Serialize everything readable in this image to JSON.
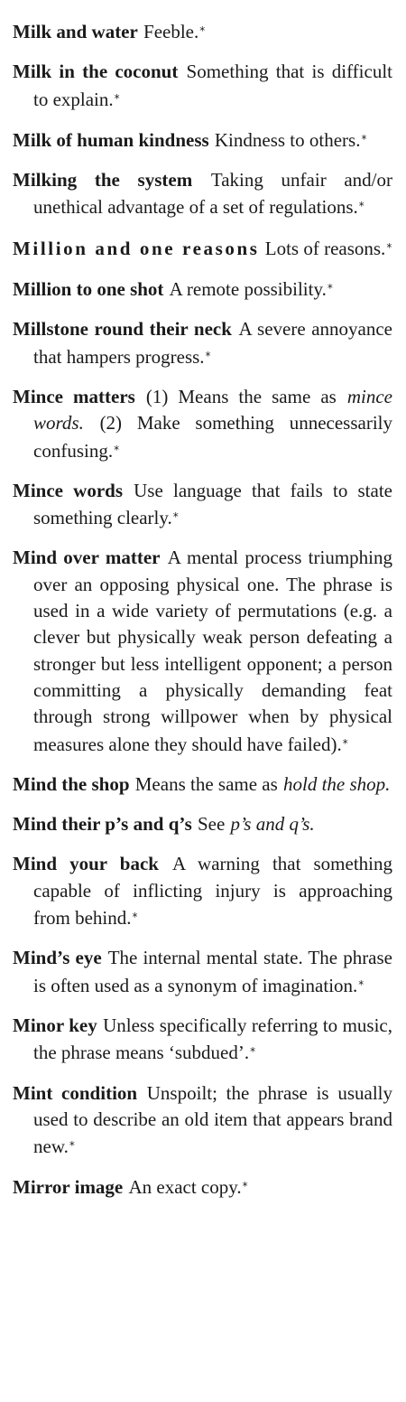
{
  "entries": [
    {
      "term": "Milk and water",
      "def": "Feeble.",
      "star": "*"
    },
    {
      "term": "Milk in the coconut",
      "def": "Something that is difficult to explain.",
      "star": "*"
    },
    {
      "term": "Milk of human kindness",
      "def": "Kindness to others.",
      "star": "*"
    },
    {
      "term": "Milking the system",
      "def": "Taking unfair and/or unethical advantage of a set of regulations.",
      "star": "*"
    },
    {
      "term": "Million and one reasons",
      "def": "Lots of reasons.",
      "star": "*"
    },
    {
      "term": "Million to one shot",
      "def": "A remote possibility.",
      "star": "*"
    },
    {
      "term": "Millstone round their neck",
      "def": "A severe annoyance that hampers progress.",
      "star": "*"
    },
    {
      "term": "Mince matters",
      "def_a": "(1) Means the same as",
      "xref": "mince words.",
      "def_b": "(2) Make something unnecessarily confusing.",
      "star": "*"
    },
    {
      "term": "Mince words",
      "def": "Use language that fails to state something clearly.",
      "star": "*"
    },
    {
      "term": "Mind over matter",
      "def": "A mental process triumphing over an opposing physical one. The phrase is used in a wide variety of permutations (e.g. a clever but physically weak person defeating a stronger but less intelligent opponent; a person committing a physically demanding feat through strong willpower when by physical measures alone they should have failed).",
      "star": "*"
    },
    {
      "term": "Mind the shop",
      "def": "Means the same as",
      "xref": "hold the shop."
    },
    {
      "term": "Mind their p’s and q’s",
      "def": "See",
      "xref": "p’s and q’s."
    },
    {
      "term": "Mind your back",
      "def": "A warning that something capable of inflicting injury is approaching from behind.",
      "star": "*"
    },
    {
      "term": "Mind’s eye",
      "def": "The internal mental state. The phrase is often used as a synonym of imagination.",
      "star": "*"
    },
    {
      "term": "Minor key",
      "def": "Unless specifically referring to music, the phrase means ‘subdued’.",
      "star": "*"
    },
    {
      "term": "Mint condition",
      "def": "Unspoilt; the phrase is usually used to describe an old item that appears brand new.",
      "star": "*"
    },
    {
      "term": "Mirror image",
      "def": "An exact copy.",
      "star": "*"
    }
  ]
}
